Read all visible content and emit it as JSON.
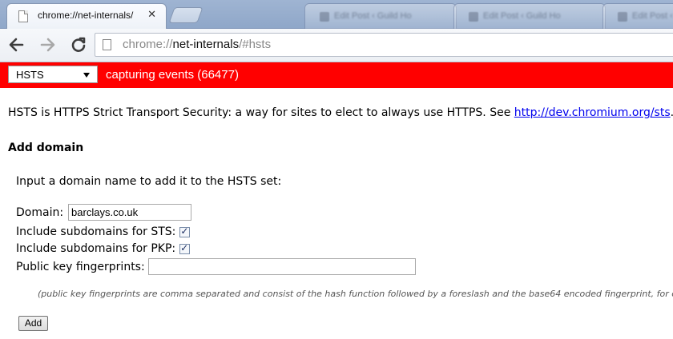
{
  "browser": {
    "active_tab": {
      "title": "chrome://net-internals/",
      "close_glyph": "✕"
    },
    "background_tabs": [
      {
        "title": "Edit Post ‹ Guild Ho"
      },
      {
        "title": "Edit Post ‹ Guild Ho"
      },
      {
        "title": "Edit Post ‹ Guild Ho"
      }
    ],
    "address_bar": {
      "scheme": "chrome://",
      "host": "net-internals",
      "path": "/#hsts"
    },
    "nav_icons": [
      "back-arrow-icon",
      "forward-arrow-icon",
      "reload-icon",
      "page-icon"
    ]
  },
  "status_bar": {
    "view_selector": {
      "selected": "HSTS"
    },
    "capture_text": "capturing events (66477)",
    "background_color": "#ff0000"
  },
  "hsts": {
    "intro_text": "HSTS is HTTPS Strict Transport Security: a way for sites to elect to always use HTTPS. See ",
    "intro_link": "http://dev.chromium.org/sts",
    "intro_suffix": ".",
    "add_domain": {
      "heading": "Add domain",
      "description": "Input a domain name to add it to the HSTS set:",
      "domain_label": "Domain:",
      "domain_value": "barclays.co.uk",
      "sts_label": "Include subdomains for STS:",
      "sts_checked": true,
      "pkp_label": "Include subdomains for PKP:",
      "pkp_checked": true,
      "fingerprints_label": "Public key fingerprints:",
      "fingerprints_value": "",
      "note": "(public key fingerprints are comma separated and consist of the hash function followed by a foreslash and the base64 encoded fingerprint, for e",
      "add_button": "Add"
    }
  }
}
